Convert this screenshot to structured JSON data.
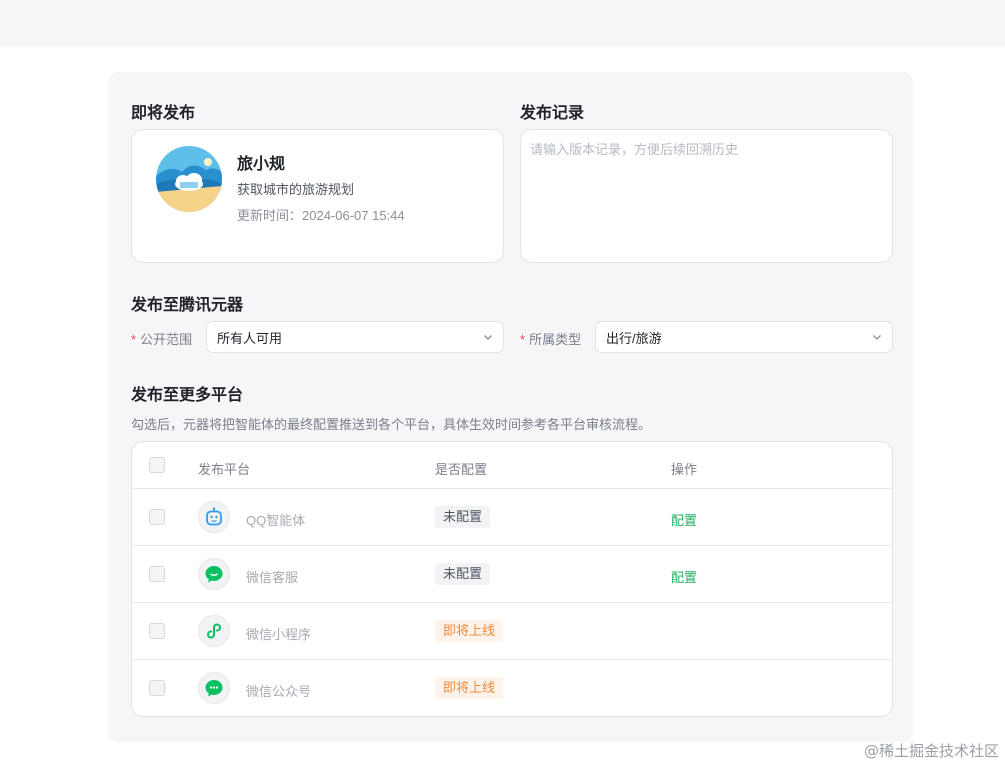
{
  "sections": {
    "upcoming": "即将发布",
    "record": "发布记录",
    "tencent": "发布至腾讯元器",
    "more": "发布至更多平台"
  },
  "app": {
    "name": "旅小规",
    "desc": "获取城市的旅游规划",
    "updated": "更新时间：2024-06-07 15:44"
  },
  "record": {
    "placeholder": "请输入版本记录，方便后续回溯历史"
  },
  "form": {
    "scope_label": "公开范围",
    "scope_value": "所有人可用",
    "type_label": "所属类型",
    "type_value": "出行/旅游",
    "required_mark": "*"
  },
  "hint": "勾选后，元器将把智能体的最终配置推送到各个平台，具体生效时间参考各平台审核流程。",
  "table": {
    "headers": {
      "platform": "发布平台",
      "configured": "是否配置",
      "action": "操作"
    },
    "rows": [
      {
        "name": "QQ智能体",
        "status": "未配置",
        "status_type": "gray",
        "action": "配置",
        "icon": "qq-bot-icon"
      },
      {
        "name": "微信客服",
        "status": "未配置",
        "status_type": "gray",
        "action": "配置",
        "icon": "wechat-service-icon"
      },
      {
        "name": "微信小程序",
        "status": "即将上线",
        "status_type": "orange",
        "action": "",
        "icon": "mini-program-icon"
      },
      {
        "name": "微信公众号",
        "status": "即将上线",
        "status_type": "orange",
        "action": "",
        "icon": "wechat-official-icon"
      }
    ]
  },
  "watermark": "@稀土掘金技术社区",
  "colors": {
    "accent_green": "#1fb062",
    "required_red": "#e5484d",
    "soon_orange": "#ee8a3b",
    "qq_blue": "#2d9cf0",
    "wechat_green": "#07c160"
  }
}
